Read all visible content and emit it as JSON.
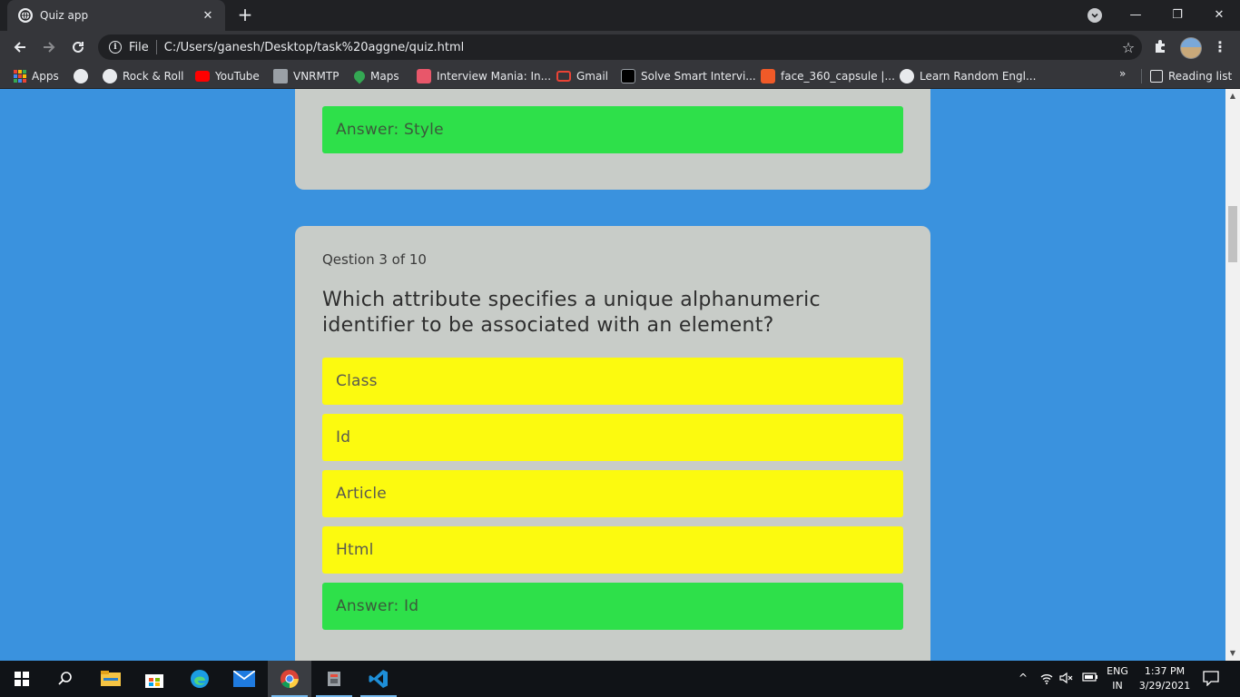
{
  "browser": {
    "tab_title": "Quiz app",
    "tab_close": "✕",
    "new_tab": "+",
    "window_controls": {
      "minimize": "—",
      "restore": "❐",
      "close": "✕"
    },
    "scheme_label": "File",
    "url": "C:/Users/ganesh/Desktop/task%20aggne/quiz.html",
    "bookmarks": [
      {
        "label": "Apps",
        "icon": "apps-grid-icon"
      },
      {
        "label": "",
        "icon": "globe-icon"
      },
      {
        "label": "Rock & Roll",
        "icon": "globe-icon"
      },
      {
        "label": "YouTube",
        "icon": "youtube-icon"
      },
      {
        "label": "VNRMTP",
        "icon": "vnrmtp-icon"
      },
      {
        "label": "Maps",
        "icon": "maps-pin-icon"
      },
      {
        "label": "Interview Mania: In...",
        "icon": "interview-mania-icon"
      },
      {
        "label": "Gmail",
        "icon": "gmail-icon"
      },
      {
        "label": "Solve Smart Intervi...",
        "icon": "smart-interviews-icon"
      },
      {
        "label": "face_360_capsule |...",
        "icon": "face-capsule-icon"
      },
      {
        "label": "Learn Random Engl...",
        "icon": "wordpress-icon"
      }
    ],
    "bookmarks_overflow": "»",
    "reading_list": "Reading list"
  },
  "quiz": {
    "previous": {
      "answer": "Answer: Style"
    },
    "current": {
      "number": "Qestion 3 of 10",
      "question": "Which attribute specifies a unique alphanumeric identifier to be associated with an element?",
      "options": [
        "Class",
        "Id",
        "Article",
        "Html"
      ],
      "answer": "Answer: Id"
    }
  },
  "colors": {
    "page_bg": "#3a92de",
    "card_bg": "#c8ccc8",
    "option_bg": "#fcfa0f",
    "answer_bg": "#2ee04a"
  },
  "taskbar": {
    "apps": [
      "windows-start-icon",
      "search-icon",
      "file-explorer-icon",
      "store-icon",
      "edge-icon",
      "mail-icon",
      "chrome-icon",
      "app-icon",
      "vscode-icon"
    ],
    "language_top": "ENG",
    "language_bottom": "IN",
    "time": "1:37 PM",
    "date": "3/29/2021"
  }
}
